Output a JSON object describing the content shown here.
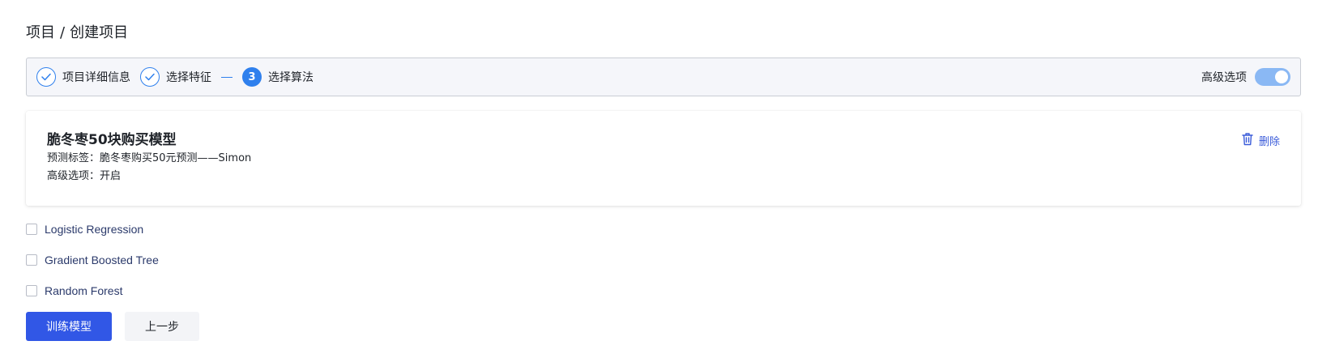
{
  "breadcrumb": {
    "parent": "项目",
    "separator": "/",
    "current": "创建项目"
  },
  "steps": [
    {
      "label": "项目详细信息",
      "status": "done",
      "icon": "check-icon"
    },
    {
      "label": "选择特征",
      "status": "done",
      "icon": "check-icon"
    },
    {
      "label": "选择算法",
      "status": "active",
      "number": "3"
    }
  ],
  "advanced_toggle": {
    "label": "高级选项",
    "on": true
  },
  "model_card": {
    "title": "脆冬枣50块购买模型",
    "label_key": "预测标签：",
    "label_value": "脆冬枣购买50元预测——Simon",
    "advanced_key": "高级选项：",
    "advanced_value": "开启",
    "delete_label": "删除",
    "delete_icon": "trash-icon"
  },
  "algorithms": [
    {
      "label": "Logistic Regression",
      "checked": false
    },
    {
      "label": "Gradient Boosted Tree",
      "checked": false
    },
    {
      "label": "Random Forest",
      "checked": false
    }
  ],
  "buttons": {
    "train": "训练模型",
    "back": "上一步"
  },
  "colors": {
    "accent": "#2f80ed",
    "primary_button": "#3157e6",
    "link": "#3a5bd9",
    "toggle_on": "#8ab8f4"
  }
}
